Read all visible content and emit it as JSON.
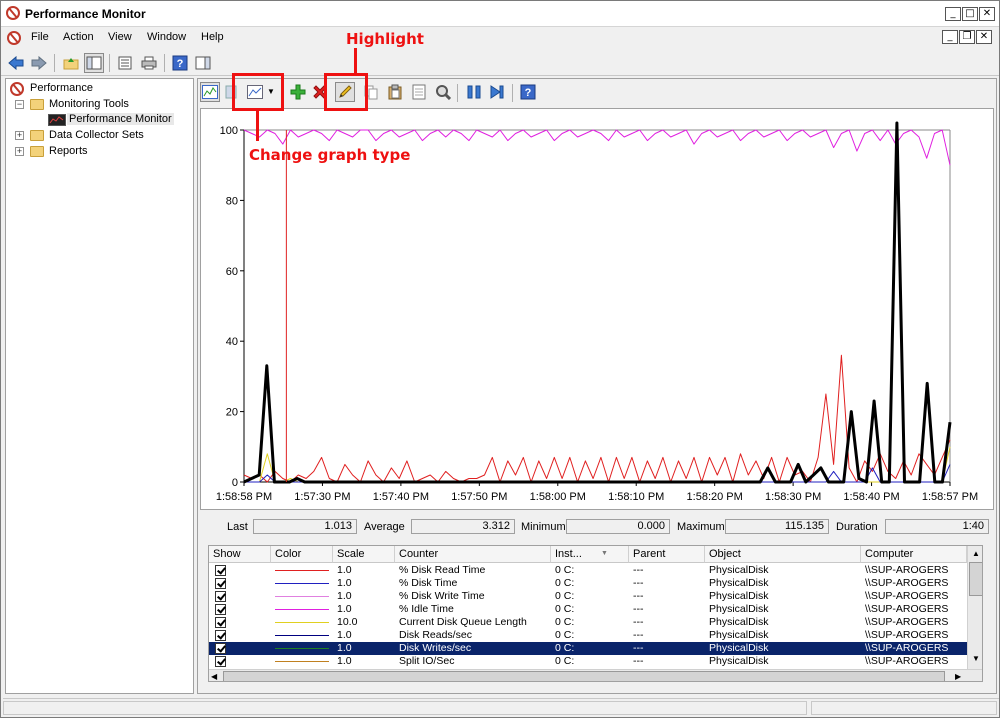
{
  "window": {
    "title": "Performance Monitor"
  },
  "menu": [
    "File",
    "Action",
    "View",
    "Window",
    "Help"
  ],
  "tree": {
    "root": "Performance",
    "monitoring_tools": "Monitoring Tools",
    "performance_monitor": "Performance Monitor",
    "data_collector_sets": "Data Collector Sets",
    "reports": "Reports"
  },
  "annotations": {
    "highlight": "Highlight",
    "change_graph_type": "Change graph type"
  },
  "chart_data": {
    "type": "line",
    "y_ticks": [
      "100",
      "80",
      "60",
      "40",
      "20",
      "0"
    ],
    "x_ticks": [
      "1:58:58 PM",
      "1:57:30 PM",
      "1:57:40 PM",
      "1:57:50 PM",
      "1:58:00 PM",
      "1:58:10 PM",
      "1:58:20 PM",
      "1:58:30 PM",
      "1:58:40 PM",
      "1:58:57 PM"
    ],
    "ylim": [
      0,
      100
    ],
    "cursor_fraction": 0.06,
    "series": [
      {
        "name": "% Disk Read Time",
        "color": "#e02020",
        "width": 1,
        "values": [
          2,
          1,
          2,
          0,
          3,
          1,
          0,
          2,
          1,
          3,
          7,
          1,
          0,
          5,
          2,
          0,
          6,
          2,
          0,
          4,
          1,
          6,
          0,
          1,
          2,
          0,
          3,
          1,
          0,
          1,
          1,
          2,
          7,
          0,
          6,
          2,
          7,
          0,
          6,
          1,
          7,
          1,
          7,
          0,
          6,
          1,
          7,
          0,
          7,
          1,
          7,
          0,
          6,
          1,
          7,
          0,
          6,
          1,
          7,
          0,
          7,
          2,
          7,
          0,
          8,
          2,
          6,
          1,
          7,
          0,
          7,
          2,
          3,
          0,
          7,
          25,
          5,
          36,
          4,
          0,
          6,
          3,
          8,
          3,
          1,
          6,
          2,
          8,
          5,
          2,
          7,
          12
        ]
      },
      {
        "name": "% Idle Time",
        "color": "#e020e0",
        "width": 1,
        "values": [
          100,
          99,
          98,
          100,
          99,
          96,
          100,
          98,
          99,
          100,
          99,
          97,
          100,
          99,
          98,
          100,
          100,
          97,
          99,
          100,
          98,
          99,
          100,
          97,
          99,
          100,
          98,
          100,
          99,
          97,
          100,
          99,
          98,
          100,
          97,
          99,
          100,
          98,
          99,
          100,
          97,
          99,
          100,
          98,
          99,
          100,
          99,
          97,
          100,
          98,
          99,
          100,
          97,
          99,
          100,
          98,
          99,
          100,
          96,
          99,
          100,
          98,
          99,
          100,
          97,
          99,
          100,
          98,
          99,
          100,
          97,
          99,
          100,
          98,
          99,
          100,
          95,
          99,
          100,
          94,
          99,
          100,
          97,
          100,
          96,
          99,
          100,
          98,
          92,
          99,
          100,
          90
        ]
      },
      {
        "name": "Current Disk Queue Length",
        "color": "#e0d020",
        "width": 1,
        "values": [
          0,
          0,
          0,
          8,
          0,
          0,
          1,
          0,
          0,
          0,
          0,
          0,
          0,
          0,
          0,
          0,
          0,
          0,
          0,
          0,
          0,
          0,
          0,
          0,
          0,
          0,
          0,
          0,
          0,
          0,
          0,
          0,
          0,
          0,
          0,
          0,
          0,
          0,
          0,
          0,
          0,
          0,
          0,
          0,
          0,
          0,
          0,
          0,
          0,
          0,
          0,
          0,
          0,
          0,
          0,
          0,
          0,
          0,
          0,
          0,
          0,
          0,
          0,
          0,
          0,
          0,
          0,
          0,
          0,
          0,
          0,
          0,
          0,
          0,
          0,
          0,
          0,
          0,
          0,
          0,
          0,
          0,
          0,
          0,
          0,
          0,
          0,
          0,
          0,
          0,
          0,
          10
        ]
      },
      {
        "name": "Disk Reads/sec",
        "color": "#2020c0",
        "width": 1,
        "values": [
          0,
          0,
          0,
          2,
          0,
          0,
          0,
          0,
          0,
          0,
          0,
          0,
          0,
          0,
          0,
          0,
          0,
          0,
          0,
          0,
          0,
          0,
          0,
          0,
          0,
          0,
          0,
          0,
          0,
          0,
          0,
          0,
          0,
          0,
          0,
          0,
          0,
          0,
          0,
          0,
          0,
          0,
          0,
          0,
          0,
          0,
          0,
          0,
          0,
          0,
          0,
          0,
          0,
          0,
          0,
          0,
          0,
          0,
          0,
          0,
          0,
          0,
          0,
          0,
          0,
          0,
          0,
          0,
          0,
          0,
          0,
          0,
          0,
          0,
          0,
          0,
          3,
          0,
          0,
          0,
          0,
          4,
          0,
          0,
          0,
          0,
          0,
          0,
          0,
          0,
          0,
          5
        ]
      },
      {
        "name": "Disk Writes/sec",
        "color": "#000000",
        "width": 3,
        "values": [
          0,
          1,
          2,
          33,
          0,
          0,
          0,
          1,
          0,
          0,
          0,
          0,
          0,
          0,
          0,
          0,
          0,
          0,
          0,
          0,
          0,
          0,
          0,
          0,
          0,
          0,
          0,
          0,
          0,
          0,
          0,
          0,
          0,
          0,
          0,
          0,
          0,
          0,
          0,
          0,
          0,
          0,
          0,
          0,
          0,
          0,
          0,
          0,
          0,
          0,
          0,
          0,
          0,
          0,
          0,
          0,
          0,
          0,
          0,
          0,
          0,
          0,
          0,
          0,
          0,
          0,
          0,
          0,
          0,
          4,
          0,
          0,
          0,
          5,
          0,
          2,
          4,
          0,
          0,
          0,
          20,
          1,
          0,
          23,
          0,
          0,
          102,
          0,
          0,
          0,
          28,
          0,
          0,
          17
        ]
      }
    ]
  },
  "stats": {
    "last_label": "Last",
    "last_value": "1.013",
    "average_label": "Average",
    "average_value": "3.312",
    "minimum_label": "Minimum",
    "minimum_value": "0.000",
    "maximum_label": "Maximum",
    "maximum_value": "115.135",
    "duration_label": "Duration",
    "duration_value": "1:40"
  },
  "grid": {
    "headers": [
      "Show",
      "Color",
      "Scale",
      "Counter",
      "Inst...",
      "Parent",
      "Object",
      "Computer"
    ],
    "rows": [
      {
        "color": "#e02020",
        "scale": "1.0",
        "counter": "% Disk Read Time",
        "instance": "0 C:",
        "parent": "---",
        "object": "PhysicalDisk",
        "computer": "\\\\SUP-AROGERS"
      },
      {
        "color": "#2020c0",
        "scale": "1.0",
        "counter": "% Disk Time",
        "instance": "0 C:",
        "parent": "---",
        "object": "PhysicalDisk",
        "computer": "\\\\SUP-AROGERS"
      },
      {
        "color": "#e080e0",
        "scale": "1.0",
        "counter": "% Disk Write Time",
        "instance": "0 C:",
        "parent": "---",
        "object": "PhysicalDisk",
        "computer": "\\\\SUP-AROGERS"
      },
      {
        "color": "#e020e0",
        "scale": "1.0",
        "counter": "% Idle Time",
        "instance": "0 C:",
        "parent": "---",
        "object": "PhysicalDisk",
        "computer": "\\\\SUP-AROGERS"
      },
      {
        "color": "#e0d020",
        "scale": "10.0",
        "counter": "Current Disk Queue Length",
        "instance": "0 C:",
        "parent": "---",
        "object": "PhysicalDisk",
        "computer": "\\\\SUP-AROGERS"
      },
      {
        "color": "#000080",
        "scale": "1.0",
        "counter": "Disk Reads/sec",
        "instance": "0 C:",
        "parent": "---",
        "object": "PhysicalDisk",
        "computer": "\\\\SUP-AROGERS"
      },
      {
        "color": "#208020",
        "scale": "1.0",
        "counter": "Disk Writes/sec",
        "instance": "0 C:",
        "parent": "---",
        "object": "PhysicalDisk",
        "computer": "\\\\SUP-AROGERS",
        "selected": true
      },
      {
        "color": "#c08020",
        "scale": "1.0",
        "counter": "Split IO/Sec",
        "instance": "0 C:",
        "parent": "---",
        "object": "PhysicalDisk",
        "computer": "\\\\SUP-AROGERS"
      }
    ]
  }
}
